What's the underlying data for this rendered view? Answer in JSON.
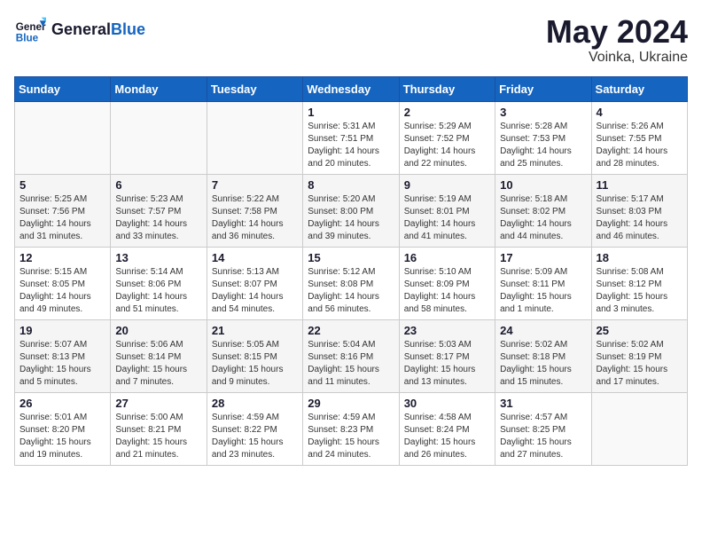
{
  "logo": {
    "text_general": "General",
    "text_blue": "Blue"
  },
  "title": {
    "month_year": "May 2024",
    "location": "Voinka, Ukraine"
  },
  "weekdays": [
    "Sunday",
    "Monday",
    "Tuesday",
    "Wednesday",
    "Thursday",
    "Friday",
    "Saturday"
  ],
  "weeks": [
    [
      {
        "day": "",
        "info": ""
      },
      {
        "day": "",
        "info": ""
      },
      {
        "day": "",
        "info": ""
      },
      {
        "day": "1",
        "info": "Sunrise: 5:31 AM\nSunset: 7:51 PM\nDaylight: 14 hours\nand 20 minutes."
      },
      {
        "day": "2",
        "info": "Sunrise: 5:29 AM\nSunset: 7:52 PM\nDaylight: 14 hours\nand 22 minutes."
      },
      {
        "day": "3",
        "info": "Sunrise: 5:28 AM\nSunset: 7:53 PM\nDaylight: 14 hours\nand 25 minutes."
      },
      {
        "day": "4",
        "info": "Sunrise: 5:26 AM\nSunset: 7:55 PM\nDaylight: 14 hours\nand 28 minutes."
      }
    ],
    [
      {
        "day": "5",
        "info": "Sunrise: 5:25 AM\nSunset: 7:56 PM\nDaylight: 14 hours\nand 31 minutes."
      },
      {
        "day": "6",
        "info": "Sunrise: 5:23 AM\nSunset: 7:57 PM\nDaylight: 14 hours\nand 33 minutes."
      },
      {
        "day": "7",
        "info": "Sunrise: 5:22 AM\nSunset: 7:58 PM\nDaylight: 14 hours\nand 36 minutes."
      },
      {
        "day": "8",
        "info": "Sunrise: 5:20 AM\nSunset: 8:00 PM\nDaylight: 14 hours\nand 39 minutes."
      },
      {
        "day": "9",
        "info": "Sunrise: 5:19 AM\nSunset: 8:01 PM\nDaylight: 14 hours\nand 41 minutes."
      },
      {
        "day": "10",
        "info": "Sunrise: 5:18 AM\nSunset: 8:02 PM\nDaylight: 14 hours\nand 44 minutes."
      },
      {
        "day": "11",
        "info": "Sunrise: 5:17 AM\nSunset: 8:03 PM\nDaylight: 14 hours\nand 46 minutes."
      }
    ],
    [
      {
        "day": "12",
        "info": "Sunrise: 5:15 AM\nSunset: 8:05 PM\nDaylight: 14 hours\nand 49 minutes."
      },
      {
        "day": "13",
        "info": "Sunrise: 5:14 AM\nSunset: 8:06 PM\nDaylight: 14 hours\nand 51 minutes."
      },
      {
        "day": "14",
        "info": "Sunrise: 5:13 AM\nSunset: 8:07 PM\nDaylight: 14 hours\nand 54 minutes."
      },
      {
        "day": "15",
        "info": "Sunrise: 5:12 AM\nSunset: 8:08 PM\nDaylight: 14 hours\nand 56 minutes."
      },
      {
        "day": "16",
        "info": "Sunrise: 5:10 AM\nSunset: 8:09 PM\nDaylight: 14 hours\nand 58 minutes."
      },
      {
        "day": "17",
        "info": "Sunrise: 5:09 AM\nSunset: 8:11 PM\nDaylight: 15 hours\nand 1 minute."
      },
      {
        "day": "18",
        "info": "Sunrise: 5:08 AM\nSunset: 8:12 PM\nDaylight: 15 hours\nand 3 minutes."
      }
    ],
    [
      {
        "day": "19",
        "info": "Sunrise: 5:07 AM\nSunset: 8:13 PM\nDaylight: 15 hours\nand 5 minutes."
      },
      {
        "day": "20",
        "info": "Sunrise: 5:06 AM\nSunset: 8:14 PM\nDaylight: 15 hours\nand 7 minutes."
      },
      {
        "day": "21",
        "info": "Sunrise: 5:05 AM\nSunset: 8:15 PM\nDaylight: 15 hours\nand 9 minutes."
      },
      {
        "day": "22",
        "info": "Sunrise: 5:04 AM\nSunset: 8:16 PM\nDaylight: 15 hours\nand 11 minutes."
      },
      {
        "day": "23",
        "info": "Sunrise: 5:03 AM\nSunset: 8:17 PM\nDaylight: 15 hours\nand 13 minutes."
      },
      {
        "day": "24",
        "info": "Sunrise: 5:02 AM\nSunset: 8:18 PM\nDaylight: 15 hours\nand 15 minutes."
      },
      {
        "day": "25",
        "info": "Sunrise: 5:02 AM\nSunset: 8:19 PM\nDaylight: 15 hours\nand 17 minutes."
      }
    ],
    [
      {
        "day": "26",
        "info": "Sunrise: 5:01 AM\nSunset: 8:20 PM\nDaylight: 15 hours\nand 19 minutes."
      },
      {
        "day": "27",
        "info": "Sunrise: 5:00 AM\nSunset: 8:21 PM\nDaylight: 15 hours\nand 21 minutes."
      },
      {
        "day": "28",
        "info": "Sunrise: 4:59 AM\nSunset: 8:22 PM\nDaylight: 15 hours\nand 23 minutes."
      },
      {
        "day": "29",
        "info": "Sunrise: 4:59 AM\nSunset: 8:23 PM\nDaylight: 15 hours\nand 24 minutes."
      },
      {
        "day": "30",
        "info": "Sunrise: 4:58 AM\nSunset: 8:24 PM\nDaylight: 15 hours\nand 26 minutes."
      },
      {
        "day": "31",
        "info": "Sunrise: 4:57 AM\nSunset: 8:25 PM\nDaylight: 15 hours\nand 27 minutes."
      },
      {
        "day": "",
        "info": ""
      }
    ]
  ]
}
